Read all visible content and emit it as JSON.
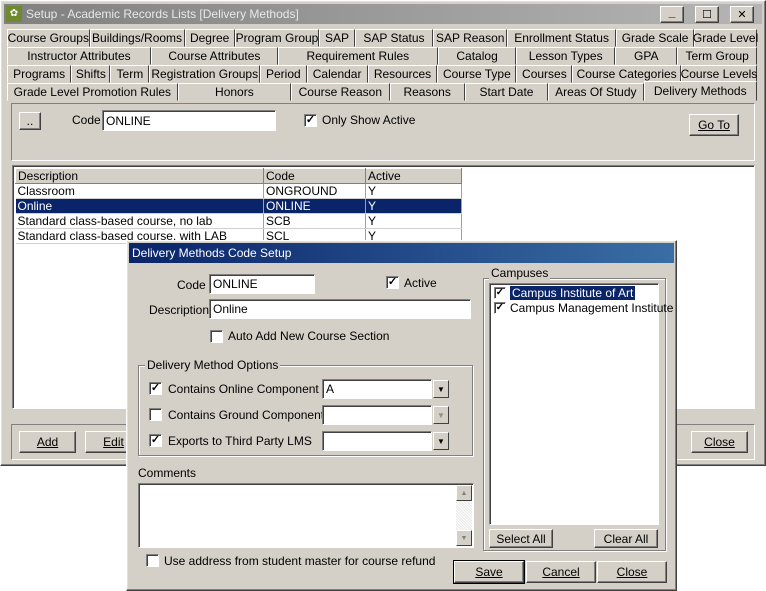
{
  "main_window": {
    "title": "Setup - Academic Records Lists [Delivery Methods]",
    "controls": {
      "minimize": "_",
      "maximize": "☐",
      "close": "✕"
    }
  },
  "tabs": {
    "row1": [
      "Course Groups",
      "Buildings/Rooms",
      "Degree",
      "Program Group",
      "SAP",
      "SAP Status",
      "SAP Reason",
      "Enrollment Status",
      "Grade Scale",
      "Grade Level"
    ],
    "row2": [
      "Instructor Attributes",
      "Course Attributes",
      "Requirement Rules",
      "Catalog",
      "Lesson Types",
      "GPA",
      "Term Group"
    ],
    "row3": [
      "Programs",
      "Shifts",
      "Term",
      "Registration Groups",
      "Period",
      "Calendar",
      "Resources",
      "Course Type",
      "Courses",
      "Course Categories",
      "Course Levels"
    ],
    "row4": [
      "Grade Level Promotion Rules",
      "Honors",
      "Course Reason",
      "Reasons",
      "Start Date",
      "Areas Of Study",
      "Delivery Methods"
    ]
  },
  "filter": {
    "ellipsis_label": "..",
    "code_label": "Code",
    "code_value": "ONLINE",
    "only_active_label": "Only Show Active",
    "only_active_checked": true,
    "goto_label": "Go To"
  },
  "grid": {
    "headers": [
      "Description",
      "Code",
      "Active"
    ],
    "rows": [
      {
        "description": "Classroom",
        "code": "ONGROUND",
        "active": "Y"
      },
      {
        "description": "Online",
        "code": "ONLINE",
        "active": "Y"
      },
      {
        "description": "Standard class-based course, no lab",
        "code": "SCB",
        "active": "Y"
      },
      {
        "description": "Standard class-based course, with LAB",
        "code": "SCL",
        "active": "Y"
      }
    ],
    "selected_index": 1
  },
  "bottom_buttons": {
    "add": "Add",
    "edit": "Edit",
    "close": "Close"
  },
  "dialog": {
    "title": "Delivery Methods Code Setup",
    "code_label": "Code",
    "code_value": "ONLINE",
    "active_label": "Active",
    "active_checked": true,
    "description_label": "Description",
    "description_value": "Online",
    "auto_add_label": "Auto Add New Course Section",
    "auto_add_checked": false,
    "options_group_label": "Delivery Method Options",
    "options": [
      {
        "label": "Contains Online Component",
        "checked": true,
        "value": "A"
      },
      {
        "label": "Contains Ground Component",
        "checked": false,
        "value": ""
      },
      {
        "label": "Exports to Third Party LMS",
        "checked": true,
        "value": ""
      }
    ],
    "comments_label": "Comments",
    "comments_value": "",
    "use_address_label": "Use address from student master for course refund",
    "use_address_checked": false,
    "campuses_label": "Campuses",
    "campuses": [
      {
        "name": "Campus Institute of Art",
        "checked": true,
        "selected": true
      },
      {
        "name": "Campus Management Institute",
        "checked": true,
        "selected": false
      }
    ],
    "select_all_label": "Select All",
    "clear_all_label": "Clear All",
    "save_label": "Save",
    "cancel_label": "Cancel",
    "close_label": "Close"
  },
  "colors": {
    "titlebar": "#808080",
    "dialog_titlebar": "#0a246a",
    "face": "#d4d0c8",
    "selection": "#0a246a"
  }
}
